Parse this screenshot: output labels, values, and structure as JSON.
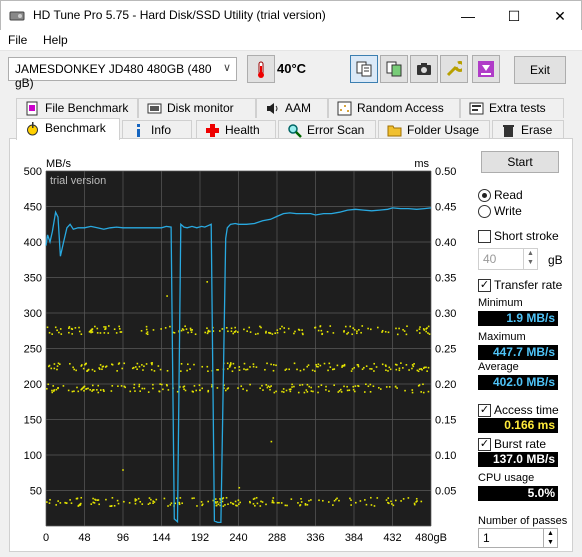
{
  "window": {
    "title": "HD Tune Pro 5.75 - Hard Disk/SSD Utility (trial version)",
    "minimize": "—",
    "maximize": "☐",
    "close": "✕"
  },
  "menu": [
    "File",
    "Help"
  ],
  "toolbar": {
    "drive": "JAMESDONKEY JD480 480GB (480 gB)",
    "temperature": "40°C",
    "exit_label": "Exit"
  },
  "tabs_top": [
    {
      "label": "File Benchmark",
      "icon": "file-icon"
    },
    {
      "label": "Disk monitor",
      "icon": "monitor-icon"
    },
    {
      "label": "AAM",
      "icon": "speaker-icon"
    },
    {
      "label": "Random Access",
      "icon": "random-icon"
    },
    {
      "label": "Extra tests",
      "icon": "extra-icon"
    }
  ],
  "tabs_bottom": [
    {
      "label": "Benchmark",
      "icon": "benchmark-icon",
      "active": true
    },
    {
      "label": "Info",
      "icon": "info-icon"
    },
    {
      "label": "Health",
      "icon": "health-icon"
    },
    {
      "label": "Error Scan",
      "icon": "magnifier-icon"
    },
    {
      "label": "Folder Usage",
      "icon": "folder-icon"
    },
    {
      "label": "Erase",
      "icon": "trash-icon"
    }
  ],
  "side": {
    "start_label": "Start",
    "read_label": "Read",
    "write_label": "Write",
    "short_stroke_label": "Short stroke",
    "stroke_value": "40",
    "stroke_unit": "gB",
    "transfer_rate_label": "Transfer rate",
    "minimum_label": "Minimum",
    "minimum_value": "1.9 MB/s",
    "maximum_label": "Maximum",
    "maximum_value": "447.7 MB/s",
    "average_label": "Average",
    "average_value": "402.0 MB/s",
    "access_time_label": "Access time",
    "access_time_value": "0.166 ms",
    "burst_rate_label": "Burst rate",
    "burst_rate_value": "137.0 MB/s",
    "cpu_label": "CPU usage",
    "cpu_value": "5.0%",
    "passes_label": "Number of passes",
    "passes_value": "1"
  },
  "chart_data": {
    "type": "line",
    "watermark": "trial version",
    "ylabel_left": "MB/s",
    "ylabel_right": "ms",
    "ylim_left": [
      0,
      500
    ],
    "ylim_right": [
      0,
      0.5
    ],
    "xlim": [
      0,
      480
    ],
    "x_ticks": [
      "0",
      "48",
      "96",
      "144",
      "192",
      "240",
      "288",
      "336",
      "384",
      "432",
      "480gB"
    ],
    "y_ticks_left": [
      "500",
      "450",
      "400",
      "350",
      "300",
      "250",
      "200",
      "150",
      "100",
      "50"
    ],
    "y_ticks_right": [
      "0.50",
      "0.45",
      "0.40",
      "0.35",
      "0.30",
      "0.25",
      "0.20",
      "0.15",
      "0.10",
      "0.05"
    ],
    "colors": {
      "transfer": "#29a9e0",
      "access": "#e6e600",
      "background": "#1e1e1e",
      "grid": "#5a5a5a"
    },
    "series": [
      {
        "name": "Transfer rate",
        "x": [
          0,
          2,
          5,
          8,
          12,
          15,
          18,
          22,
          26,
          30,
          34,
          40,
          48,
          56,
          64,
          72,
          80,
          88,
          96,
          104,
          112,
          120,
          128,
          136,
          144,
          150,
          156,
          160,
          164,
          168,
          172,
          176,
          182,
          188,
          194,
          198,
          202,
          206,
          210,
          214,
          218,
          224,
          226,
          230,
          236,
          240,
          250,
          260,
          270,
          280,
          288,
          296,
          304,
          312,
          320,
          330,
          336,
          346,
          356,
          366,
          376,
          386,
          396,
          406,
          416,
          426,
          432,
          442,
          452,
          462,
          472,
          480
        ],
        "y": [
          395,
          410,
          400,
          415,
          442,
          435,
          380,
          400,
          420,
          425,
          418,
          420,
          420,
          422,
          420,
          418,
          420,
          421,
          420,
          420,
          420,
          420,
          420,
          420,
          420,
          422,
          421,
          10,
          6,
          425,
          421,
          420,
          422,
          420,
          422,
          421,
          423,
          425,
          7,
          5,
          5,
          405,
          420,
          425,
          426,
          425,
          425,
          426,
          430,
          432,
          436,
          440,
          441,
          440,
          440,
          440,
          438,
          440,
          440,
          442,
          445,
          446,
          445,
          444,
          445,
          446,
          448,
          447,
          447,
          446,
          447,
          448
        ]
      },
      {
        "name": "Access time",
        "bands": [
          0.035,
          0.195,
          0.225,
          0.277
        ],
        "outliers": [
          [
            150,
            0.325
          ],
          [
            200,
            0.345
          ],
          [
            95,
            0.08
          ],
          [
            240,
            0.055
          ],
          [
            280,
            0.12
          ]
        ]
      }
    ]
  }
}
